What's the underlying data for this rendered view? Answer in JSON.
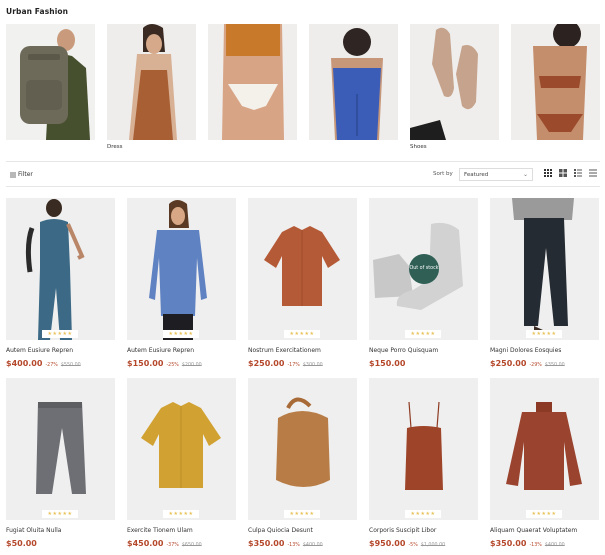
{
  "shop": {
    "title": "Urban Fashion"
  },
  "categories": [
    {
      "label": "",
      "image": "backpack-model"
    },
    {
      "label": "Dress",
      "image": "halter-dress-model"
    },
    {
      "label": "",
      "image": "bikini-bottom-model"
    },
    {
      "label": "",
      "image": "blue-top-model"
    },
    {
      "label": "Shoes",
      "image": "flats-model"
    },
    {
      "label": "",
      "image": "swimsuit-model"
    }
  ],
  "toolbar": {
    "filter_label": "Filter",
    "sort_label": "Sort by",
    "sort_value": "Featured",
    "views": [
      "grid-4-icon",
      "grid-2-icon",
      "list-icon",
      "list-compact-icon"
    ]
  },
  "products": [
    {
      "name": "Autem Eusiure Repren",
      "price": "$400.00",
      "discount": "-27%",
      "old_price": "$550.00",
      "stars": "★★★★★",
      "badge": "",
      "image": "teal-jumpsuit"
    },
    {
      "name": "Autem Eusiure Repren",
      "price": "$150.00",
      "discount": "-25%",
      "old_price": "$200.00",
      "stars": "★★★★★",
      "badge": "",
      "image": "blue-shirt"
    },
    {
      "name": "Nostrum Exercitationem",
      "price": "$250.00",
      "discount": "-17%",
      "old_price": "$300.00",
      "stars": "★★★★★",
      "badge": "",
      "image": "rust-shirt"
    },
    {
      "name": "Neque Porro Quisquam",
      "price": "$150.00",
      "discount": "",
      "old_price": "",
      "stars": "★★★★★",
      "badge": "Out of stock",
      "image": "grey-boots"
    },
    {
      "name": "Magni Dolores Eosquies",
      "price": "$250.00",
      "discount": "-29%",
      "old_price": "$350.00",
      "stars": "★★★★★",
      "badge": "",
      "image": "dark-trousers"
    },
    {
      "name": "Fugiat Oluita Nulla",
      "price": "$50.00",
      "discount": "",
      "old_price": "",
      "stars": "★★★★★",
      "badge": "",
      "image": "grey-trousers"
    },
    {
      "name": "Exercite Tionem Ulam",
      "price": "$450.00",
      "discount": "-37%",
      "old_price": "$650.00",
      "stars": "★★★★★",
      "badge": "",
      "image": "mustard-shirt"
    },
    {
      "name": "Culpa Quiocia Desunt",
      "price": "$350.00",
      "discount": "-13%",
      "old_price": "$400.00",
      "stars": "★★★★★",
      "badge": "",
      "image": "tan-bag"
    },
    {
      "name": "Corporis Suscipit Libor",
      "price": "$950.00",
      "discount": "-5%",
      "old_price": "$1,000.00",
      "stars": "★★★★★",
      "badge": "",
      "image": "rust-camisole"
    },
    {
      "name": "Aliquam Quaerat Voluptatem",
      "price": "$350.00",
      "discount": "-13%",
      "old_price": "$400.00",
      "stars": "★★★★★",
      "badge": "",
      "image": "rust-sweater"
    }
  ],
  "colors": {
    "accent": "#b5482b",
    "badge": "#2f5f55",
    "star": "#e8c25a",
    "tile": "#efefef"
  }
}
